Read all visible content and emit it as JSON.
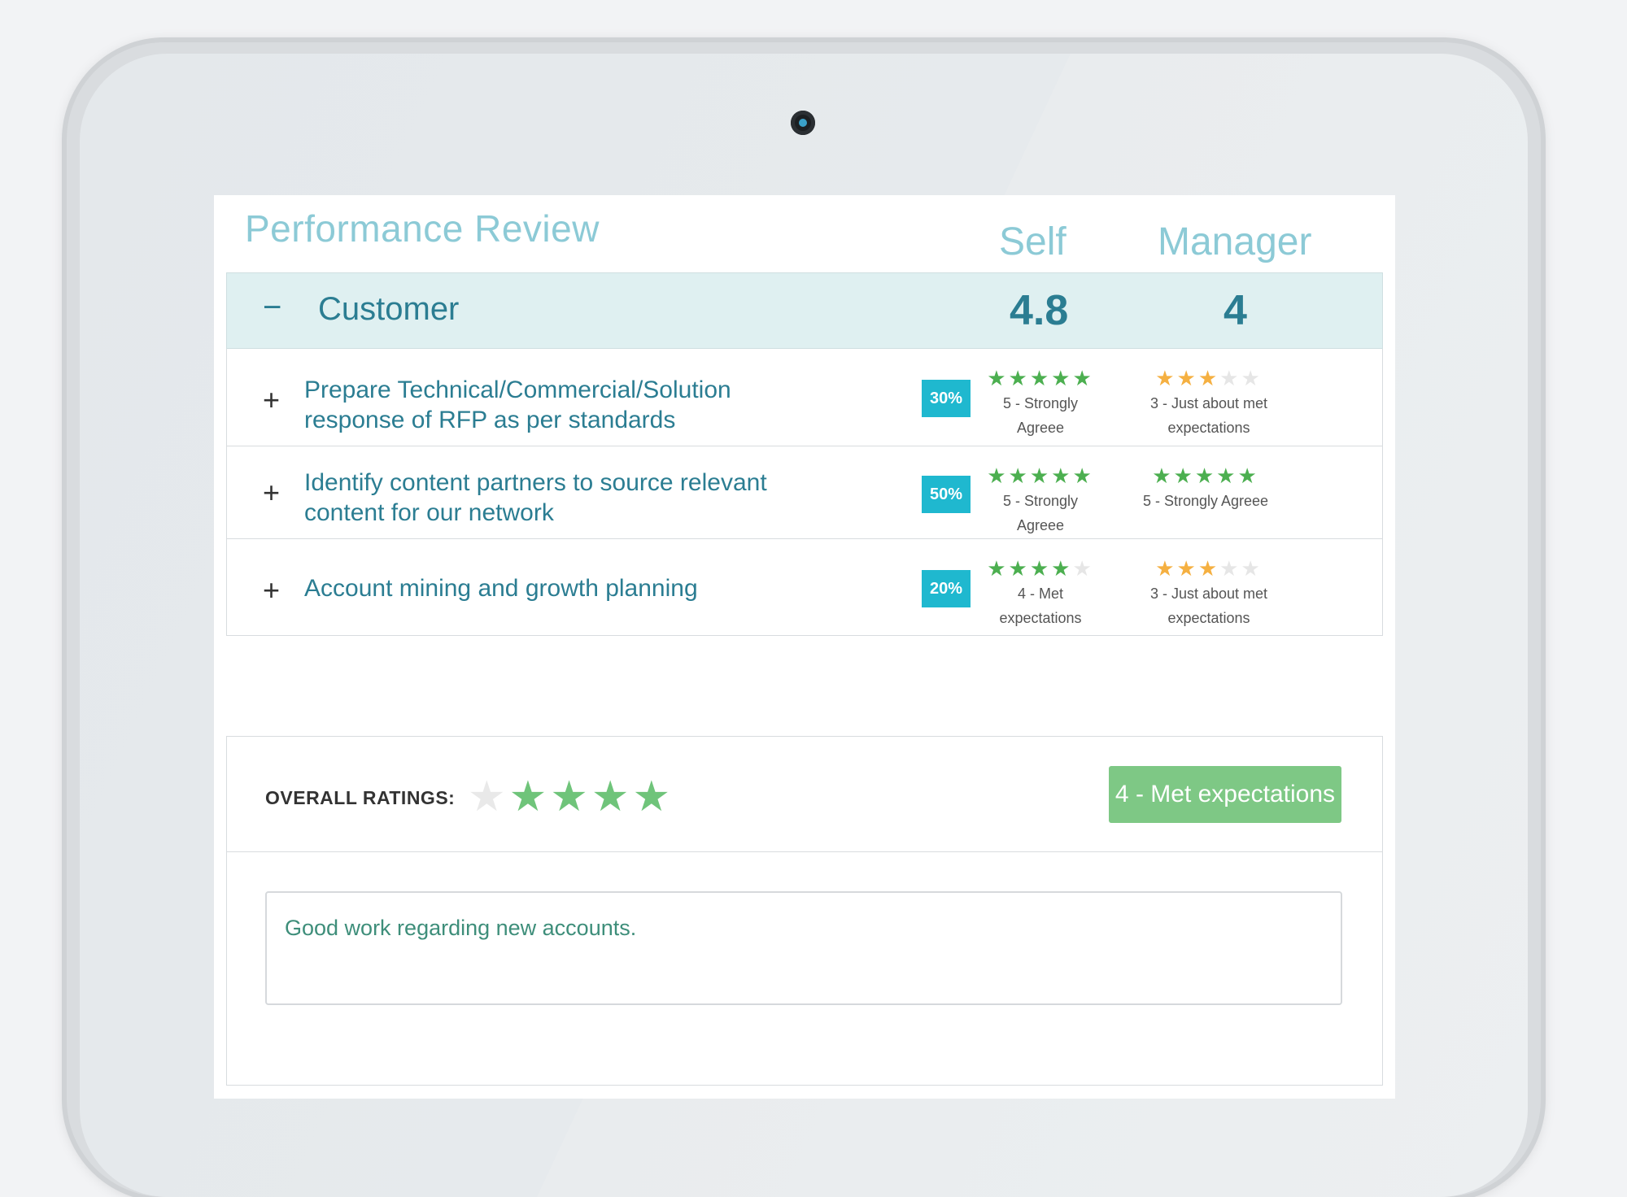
{
  "review": {
    "title": "Performance Review",
    "columns": {
      "self": "Self",
      "manager": "Manager"
    }
  },
  "section": {
    "toggle": "−",
    "name": "Customer",
    "self_score": "4.8",
    "manager_score": "4"
  },
  "goals": [
    {
      "expand": "+",
      "label": "Prepare Technical/Commercial/Solution response of RFP as per standards",
      "weight": "30%",
      "self": {
        "stars": 5,
        "text": "5 - Strongly Agreee"
      },
      "manager": {
        "stars": 3,
        "text": "3 - Just about met expectations"
      }
    },
    {
      "expand": "+",
      "label": "Identify content partners to source relevant content for our network",
      "weight": "50%",
      "self": {
        "stars": 5,
        "text": "5 - Strongly Agreee"
      },
      "manager": {
        "stars": 5,
        "text": "5 - Strongly Agreee"
      }
    },
    {
      "expand": "+",
      "label": "Account mining and growth planning",
      "weight": "20%",
      "self": {
        "stars": 4,
        "text": "4 - Met expectations"
      },
      "manager": {
        "stars": 3,
        "text": "3 - Just about met expectations"
      }
    }
  ],
  "overall": {
    "label": "OVERALL RATINGS:",
    "stars": 4,
    "badge": "4 - Met expectations"
  },
  "comment": {
    "text": "Good work regarding new accounts."
  },
  "colors": {
    "accent": "#2b7d92",
    "title": "#8ccad6",
    "weight_badge": "#1fb8cf",
    "star_green": "#4caf50",
    "star_orange": "#f5b041",
    "overall_badge": "#7ec885"
  }
}
